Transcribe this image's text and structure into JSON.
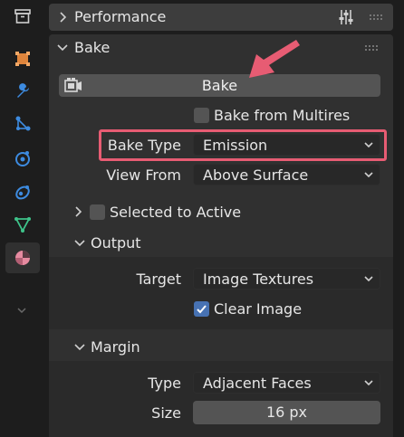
{
  "sidebar": {
    "tabs": [
      {
        "name": "collection-tab",
        "icon": "archive-box-icon"
      },
      {
        "name": "object-tab",
        "icon": "object-square-icon"
      },
      {
        "name": "modifier-tab",
        "icon": "wrench-icon"
      },
      {
        "name": "particles-tab",
        "icon": "particles-icon"
      },
      {
        "name": "physics-tab",
        "icon": "physics-icon"
      },
      {
        "name": "constraint-tab",
        "icon": "constraint-icon"
      },
      {
        "name": "data-tab",
        "icon": "mesh-data-icon"
      },
      {
        "name": "material-tab",
        "icon": "material-sphere-icon"
      }
    ],
    "colors": {
      "orange": "#e0853c",
      "blue": "#3d8be0",
      "green": "#3ec38a",
      "pink": "#e68aa0"
    }
  },
  "performance_panel": {
    "title": "Performance"
  },
  "bake_panel": {
    "title": "Bake",
    "bake_button": "Bake",
    "bake_from_multires": {
      "label": "Bake from Multires",
      "checked": false
    },
    "bake_type": {
      "label": "Bake Type",
      "value": "Emission"
    },
    "view_from": {
      "label": "View From",
      "value": "Above Surface"
    },
    "selected_to_active": {
      "label": "Selected to Active",
      "checked": false
    },
    "output": {
      "title": "Output",
      "target": {
        "label": "Target",
        "value": "Image Textures"
      },
      "clear_image": {
        "label": "Clear Image",
        "checked": true
      }
    },
    "margin": {
      "title": "Margin",
      "type": {
        "label": "Type",
        "value": "Adjacent Faces"
      },
      "size": {
        "label": "Size",
        "value": "16 px"
      }
    }
  },
  "annotation": {
    "color": "#e75c73"
  }
}
